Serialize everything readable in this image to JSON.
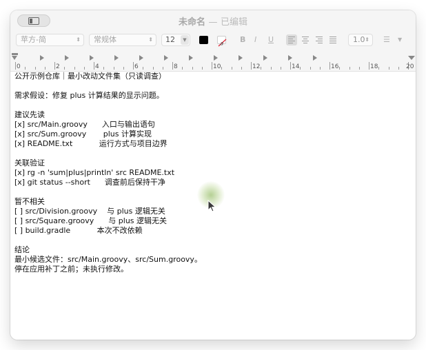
{
  "window": {
    "title": "未命名",
    "separator": "—",
    "state": "已编辑"
  },
  "toolbar": {
    "font_family": "苹方-简",
    "font_style": "常规体",
    "font_size": "12",
    "bold_label": "B",
    "italic_label": "I",
    "underline_label": "U",
    "line_spacing": "1.0",
    "text_color": "#000000"
  },
  "ruler": {
    "numbers": [
      "0",
      "2",
      "4",
      "6",
      "8",
      "10",
      "12",
      "14",
      "16",
      "18",
      "20"
    ]
  },
  "document": {
    "lines": [
      "公开示例仓库｜最小改动文件集（只读调查）",
      "",
      "需求假设：修复 plus 计算结果的显示问题。",
      "",
      "建议先读",
      "[x] src/Main.groovy      入口与输出语句",
      "[x] src/Sum.groovy       plus 计算实现",
      "[x] README.txt           运行方式与项目边界",
      "",
      "关联验证",
      "[x] rg -n 'sum|plus|println' src README.txt",
      "[x] git status --short      调查前后保持干净",
      "",
      "暂不相关",
      "[ ] src/Division.groovy    与 plus 逻辑无关",
      "[ ] src/Square.groovy      与 plus 逻辑无关",
      "[ ] build.gradle           本次不改依赖",
      "",
      "结论",
      "最小候选文件：src/Main.groovy、src/Sum.groovy。",
      "停在应用补丁之前；未执行修改。"
    ]
  }
}
